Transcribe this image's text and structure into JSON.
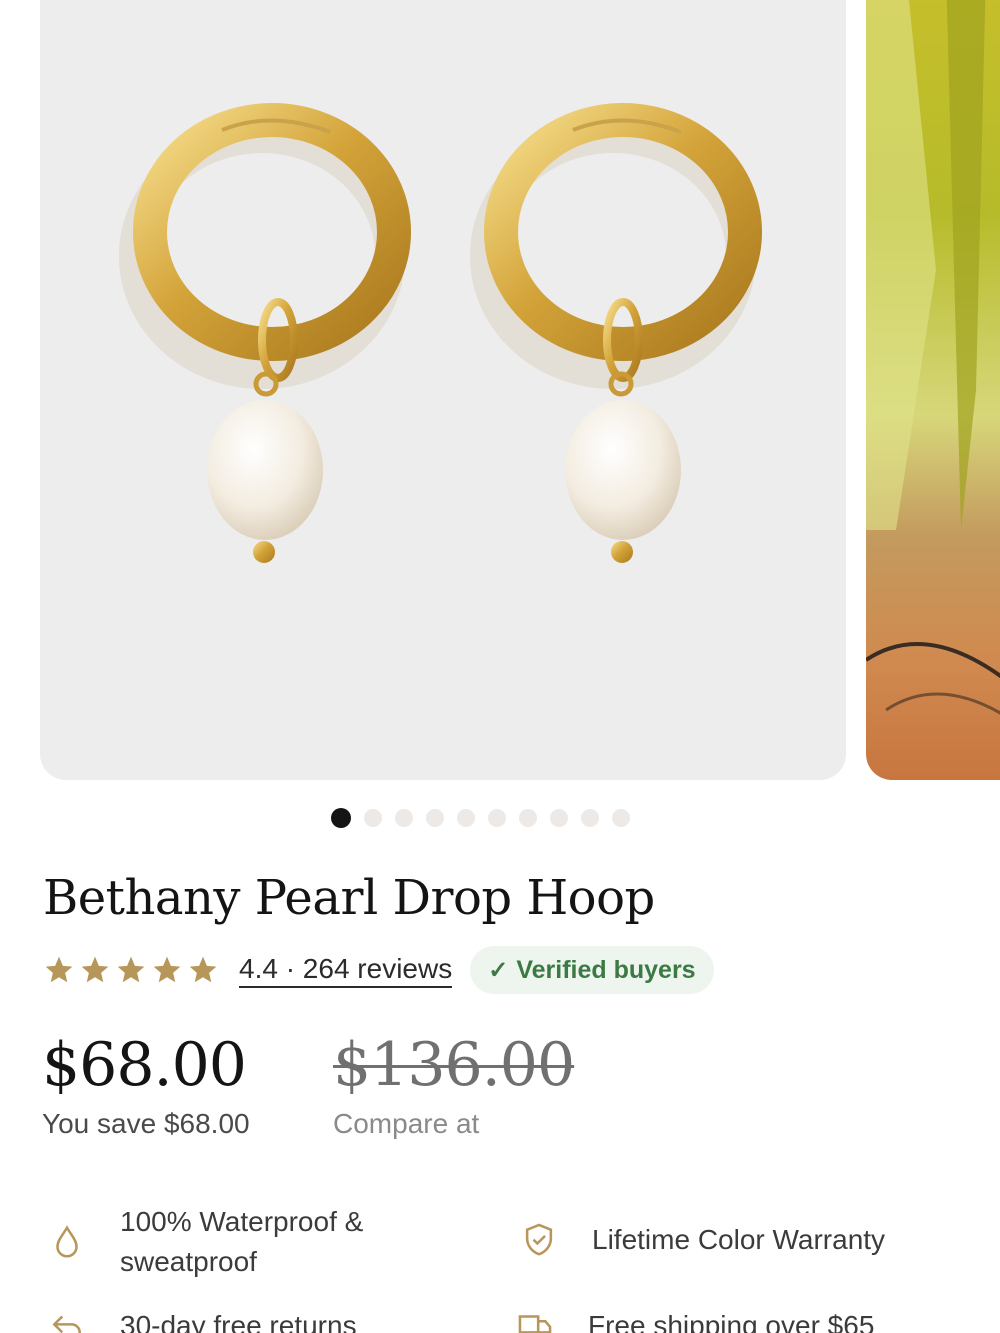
{
  "gallery": {
    "image_count": 10,
    "active_index": 0,
    "main_image_alt": "Gold hoop earrings with pearl drops"
  },
  "product": {
    "title": "Bethany Pearl Drop Hoop",
    "rating_value": 4.4,
    "rating_text": "4.4 · 264 reviews",
    "verified_label": "Verified buyers",
    "star_color": "#b7965a"
  },
  "price": {
    "current": "$68.00",
    "savings": "You save $68.00",
    "compare": "$136.00",
    "compare_label": "Compare at"
  },
  "features": [
    {
      "icon": "water-drop-icon",
      "label": "100% Waterproof & sweatproof"
    },
    {
      "icon": "shield-check-icon",
      "label": "Lifetime Color Warranty"
    },
    {
      "icon": "return-arrow-icon",
      "label": "30-day free returns"
    },
    {
      "icon": "shipping-truck-icon",
      "label": "Free shipping over $65"
    }
  ],
  "colors": {
    "accent_gold": "#b7965a",
    "verified_green": "#3c7a44",
    "verified_bg": "#eef4ee"
  }
}
